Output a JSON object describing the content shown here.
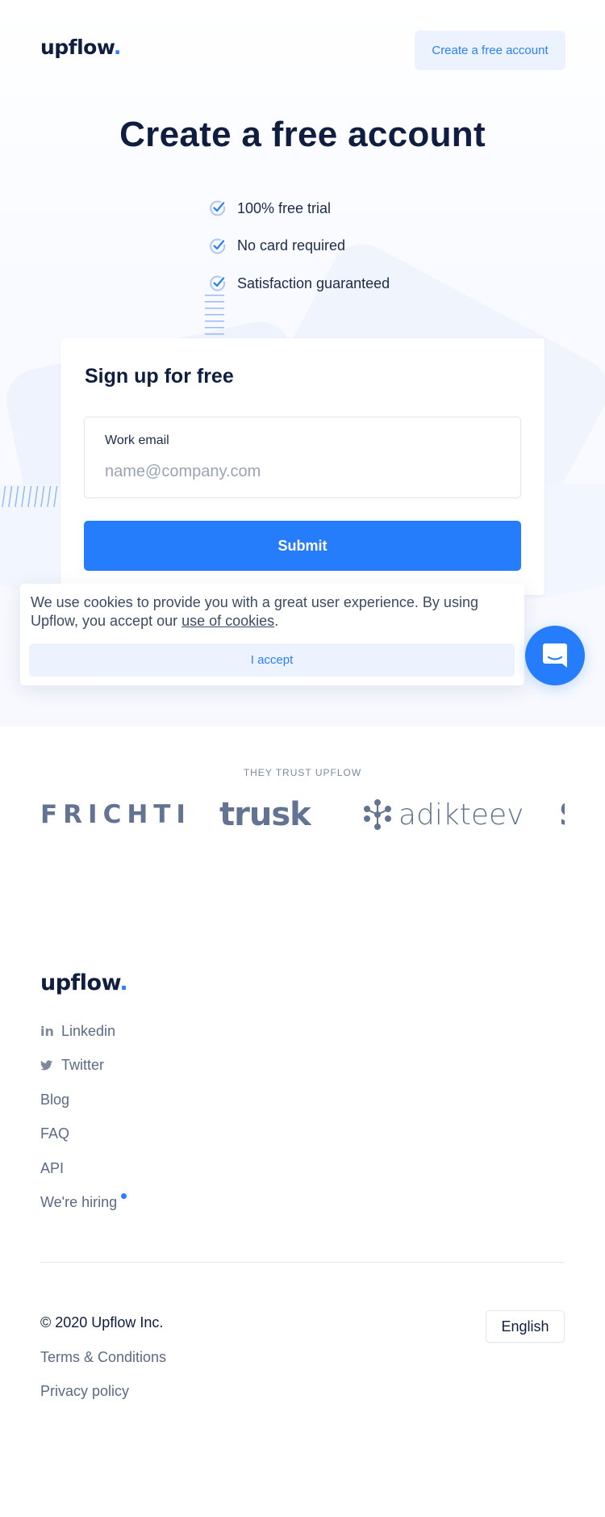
{
  "header": {
    "logo_text": "upflow",
    "logo_dot": ".",
    "cta_label": "Create a free account"
  },
  "hero": {
    "title": "Create a free account",
    "benefits": [
      "100% free trial",
      "No card required",
      "Satisfaction guaranteed"
    ]
  },
  "signup_card": {
    "title": "Sign up for free",
    "email_label": "Work email",
    "email_value": "",
    "email_placeholder": "name@company.com",
    "submit_label": "Submit"
  },
  "cookie_banner": {
    "text_before": "We use cookies to provide you with a great user experience. By using Upflow, you accept our ",
    "link_text": "use of cookies",
    "text_after": ".",
    "accept_label": "I accept"
  },
  "chat_widget": {
    "icon": "chat-bubble-icon"
  },
  "trust": {
    "label": "THEY TRUST UPFLOW",
    "brands": [
      "FRICHTI",
      "trusk",
      "adikteev",
      "S"
    ]
  },
  "footer": {
    "logo_text": "upflow",
    "logo_dot": ".",
    "links": [
      {
        "label": "Linkedin",
        "icon": "linkedin-icon"
      },
      {
        "label": "Twitter",
        "icon": "twitter-icon"
      },
      {
        "label": "Blog"
      },
      {
        "label": "FAQ"
      },
      {
        "label": "API"
      },
      {
        "label": "We're hiring",
        "badge": "dot"
      }
    ],
    "copyright": "© 2020 Upflow Inc.",
    "terms": "Terms & Conditions",
    "privacy": "Privacy policy",
    "language": "English"
  },
  "colors": {
    "accent": "#267dfc",
    "accent_light": "#ecf3fe",
    "text_dark": "#0e1d40",
    "text_muted": "#5b6a84",
    "brand_gray": "#637492"
  }
}
